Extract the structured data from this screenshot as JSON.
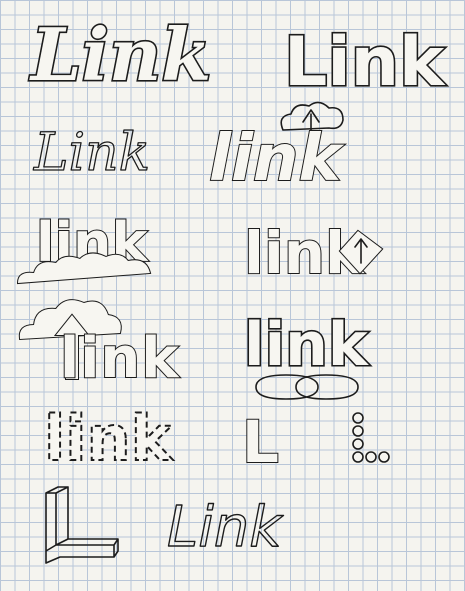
{
  "sheet": {
    "background_color": "#f5f4ef",
    "grid_color": "#b9c6d8",
    "ink_color": "#1c1c1c"
  },
  "sketches": [
    {
      "id": "script-link",
      "text": "Link"
    },
    {
      "id": "block-link",
      "text": "Link"
    },
    {
      "id": "thin-script-link",
      "text": "Link"
    },
    {
      "id": "cloud-arrow-link",
      "text": "link"
    },
    {
      "id": "cloud-base-link",
      "text": "link"
    },
    {
      "id": "diamond-arrow-link",
      "text": "link"
    },
    {
      "id": "cloud-up-arrow-link",
      "text": "link"
    },
    {
      "id": "chain-link",
      "text": "link"
    },
    {
      "id": "dashed-link",
      "text": "link"
    },
    {
      "id": "l-dots-mark",
      "text": "L"
    },
    {
      "id": "3d-l-mark",
      "text": "L"
    },
    {
      "id": "block-L-link",
      "text": "Link"
    }
  ]
}
